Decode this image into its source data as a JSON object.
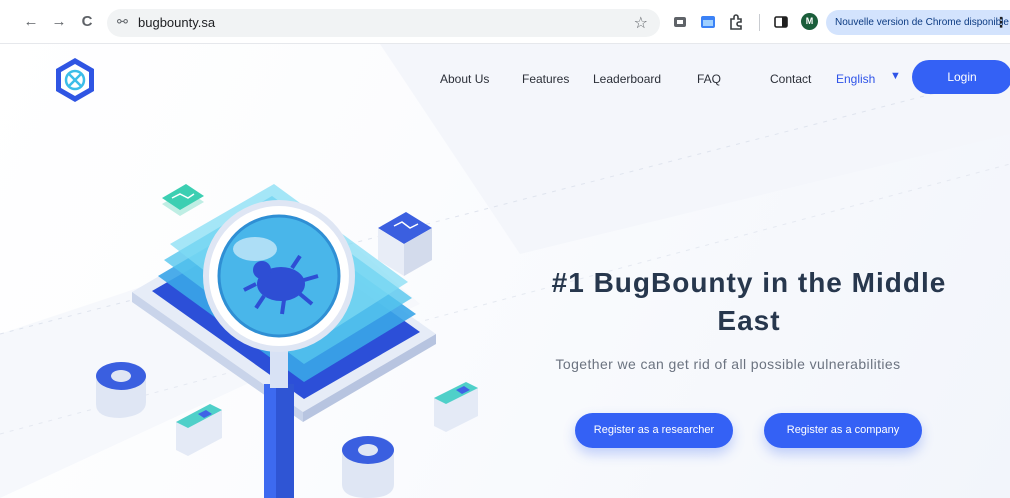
{
  "browser": {
    "url": "bugbounty.sa",
    "update_notice": "Nouvelle version de Chrome disponible",
    "profile_initial": "M",
    "back_glyph": "←",
    "forward_glyph": "→",
    "reload_glyph": "C",
    "menu_glyph": "⋮",
    "star_glyph": "☆",
    "tune_glyph": "⚯"
  },
  "nav": {
    "links": [
      "About Us",
      "Features",
      "Leaderboard",
      "FAQ",
      "Contact"
    ],
    "language": "English",
    "caret": "▼",
    "login_label": "Login"
  },
  "hero": {
    "title": "#1 BugBounty in the Middle East",
    "subtitle": "Together we can get rid of all possible vulnerabilities",
    "cta_researcher": "Register as a researcher",
    "cta_company": "Register as a company"
  },
  "icons": {
    "logo": "shield-bug-icon",
    "back": "arrow-left-icon",
    "forward": "arrow-right-icon",
    "reload": "reload-icon",
    "bookmark": "star-icon",
    "menu": "kebab-menu-icon"
  },
  "colors": {
    "brand": "#3461f5",
    "text_dark": "#27374d",
    "text_muted": "#6b7380",
    "update_bg": "#d3e3fd"
  }
}
